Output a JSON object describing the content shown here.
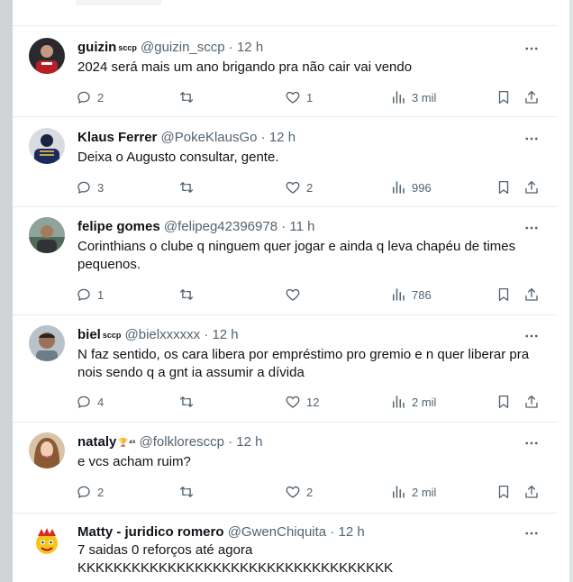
{
  "tweets": [
    {
      "name": "guizin",
      "badge": "sccp",
      "handle": "@guizin_sccp",
      "time": "12 h",
      "text": "2024 será mais um ano brigando pra não cair vai vendo",
      "replies": "2",
      "retweets": "",
      "likes": "1",
      "views": "3 mil"
    },
    {
      "name": "Klaus Ferrer",
      "badge": "",
      "handle": "@PokeKlausGo",
      "time": "12 h",
      "text": "Deixa o Augusto consultar, gente.",
      "replies": "3",
      "retweets": "",
      "likes": "2",
      "views": "996"
    },
    {
      "name": "felipe gomes",
      "badge": "",
      "handle": "@felipeg42396978",
      "time": "11 h",
      "text": "Corinthians o clube q ninguem quer jogar e ainda q leva chapéu de times pequenos.",
      "replies": "1",
      "retweets": "",
      "likes": "",
      "views": "786"
    },
    {
      "name": "biel",
      "badge": "sccp",
      "handle": "@bielxxxxxx",
      "time": "12 h",
      "text": "N faz sentido, os cara libera por empréstimo pro gremio e n quer liberar pra nois sendo q a gnt ia assumir a dívida",
      "replies": "4",
      "retweets": "",
      "likes": "12",
      "views": "2 mil"
    },
    {
      "name": "nataly",
      "badge": "🏆⁴ˣ",
      "handle": "@folkloresccp",
      "time": "12 h",
      "text": "e vcs acham ruim?",
      "replies": "2",
      "retweets": "",
      "likes": "2",
      "views": "2 mil"
    },
    {
      "name": "Matty - juridico romero",
      "badge": "",
      "handle": "@GwenChiquita",
      "time": "12 h",
      "text": "7 saidas 0 reforços até agora\nKKKKKKKKKKKKKKKKKKKKKKKKKKKKKKKKKKK"
    }
  ],
  "separator": " · ",
  "icons": {
    "reply": "reply-icon",
    "retweet": "retweet-icon",
    "like": "heart-icon",
    "views": "views-icon",
    "bookmark": "bookmark-icon",
    "share": "share-icon",
    "more": "more-icon"
  },
  "colors": {
    "text": "#0f1419",
    "secondary": "#536471",
    "divider": "#e6ecf0"
  }
}
